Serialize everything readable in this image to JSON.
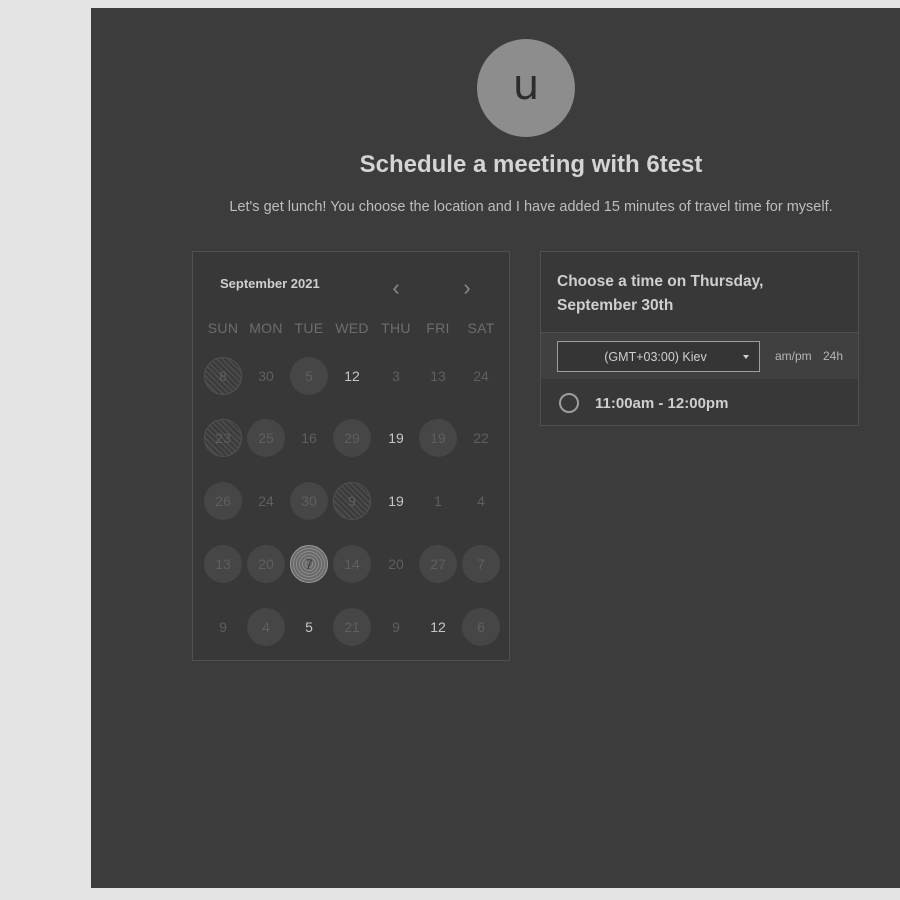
{
  "host": {
    "avatar_initial": "u",
    "title": "Schedule a meeting with 6test",
    "description": "Let's get lunch! You choose the location and I have added 15 minutes of travel time for myself."
  },
  "calendar": {
    "month_label": "September 2021",
    "weekdays": [
      "SUN",
      "MON",
      "TUE",
      "WED",
      "THU",
      "FRI",
      "SAT"
    ],
    "weeks": [
      [
        {
          "d": "8",
          "s": "hatch"
        },
        {
          "d": "30",
          "s": "plain"
        },
        {
          "d": "5",
          "s": "avail"
        },
        {
          "d": "12",
          "s": "bright"
        },
        {
          "d": "3",
          "s": "plain"
        },
        {
          "d": "13",
          "s": "plain"
        },
        {
          "d": "24",
          "s": "plain"
        }
      ],
      [
        {
          "d": "23",
          "s": "hatch"
        },
        {
          "d": "25",
          "s": "avail"
        },
        {
          "d": "16",
          "s": "plain"
        },
        {
          "d": "29",
          "s": "avail"
        },
        {
          "d": "19",
          "s": "bright"
        },
        {
          "d": "19",
          "s": "avail"
        },
        {
          "d": "22",
          "s": "plain"
        }
      ],
      [
        {
          "d": "26",
          "s": "avail"
        },
        {
          "d": "24",
          "s": "plain"
        },
        {
          "d": "30",
          "s": "avail"
        },
        {
          "d": "9",
          "s": "hatch"
        },
        {
          "d": "19",
          "s": "bright"
        },
        {
          "d": "1",
          "s": "plain"
        },
        {
          "d": "4",
          "s": "plain"
        }
      ],
      [
        {
          "d": "13",
          "s": "avail"
        },
        {
          "d": "20",
          "s": "avail"
        },
        {
          "d": "7",
          "s": "selected"
        },
        {
          "d": "14",
          "s": "avail"
        },
        {
          "d": "20",
          "s": "plain"
        },
        {
          "d": "27",
          "s": "avail"
        },
        {
          "d": "7",
          "s": "avail"
        }
      ],
      [
        {
          "d": "9",
          "s": "plain"
        },
        {
          "d": "4",
          "s": "avail"
        },
        {
          "d": "5",
          "s": "bright"
        },
        {
          "d": "21",
          "s": "avail"
        },
        {
          "d": "9",
          "s": "plain"
        },
        {
          "d": "12",
          "s": "bright"
        },
        {
          "d": "6",
          "s": "avail"
        }
      ]
    ],
    "prev_icon": "chevron-left-icon",
    "next_icon": "chevron-right-icon"
  },
  "time_picker": {
    "heading": "Choose a time on Thursday, September 30th",
    "timezone": "(GMT+03:00) Kiev",
    "format_ampm": "am/pm",
    "format_24h": "24h",
    "slots": [
      "11:00am - 12:00pm"
    ]
  }
}
